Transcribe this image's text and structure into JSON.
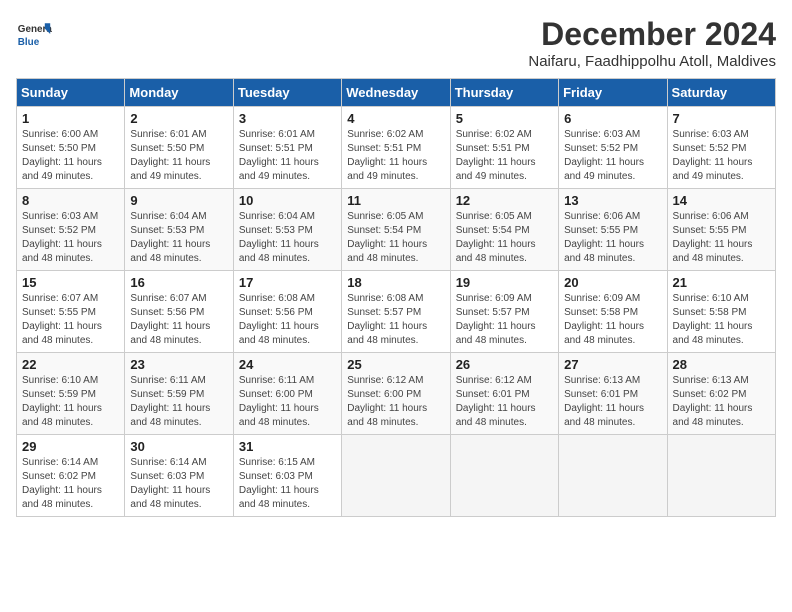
{
  "header": {
    "title": "December 2024",
    "location": "Naifaru, Faadhippolhu Atoll, Maldives",
    "logo_general": "General",
    "logo_blue": "Blue"
  },
  "days_of_week": [
    "Sunday",
    "Monday",
    "Tuesday",
    "Wednesday",
    "Thursday",
    "Friday",
    "Saturday"
  ],
  "weeks": [
    [
      {
        "day": "1",
        "info": "Sunrise: 6:00 AM\nSunset: 5:50 PM\nDaylight: 11 hours\nand 49 minutes."
      },
      {
        "day": "2",
        "info": "Sunrise: 6:01 AM\nSunset: 5:50 PM\nDaylight: 11 hours\nand 49 minutes."
      },
      {
        "day": "3",
        "info": "Sunrise: 6:01 AM\nSunset: 5:51 PM\nDaylight: 11 hours\nand 49 minutes."
      },
      {
        "day": "4",
        "info": "Sunrise: 6:02 AM\nSunset: 5:51 PM\nDaylight: 11 hours\nand 49 minutes."
      },
      {
        "day": "5",
        "info": "Sunrise: 6:02 AM\nSunset: 5:51 PM\nDaylight: 11 hours\nand 49 minutes."
      },
      {
        "day": "6",
        "info": "Sunrise: 6:03 AM\nSunset: 5:52 PM\nDaylight: 11 hours\nand 49 minutes."
      },
      {
        "day": "7",
        "info": "Sunrise: 6:03 AM\nSunset: 5:52 PM\nDaylight: 11 hours\nand 49 minutes."
      }
    ],
    [
      {
        "day": "8",
        "info": "Sunrise: 6:03 AM\nSunset: 5:52 PM\nDaylight: 11 hours\nand 48 minutes."
      },
      {
        "day": "9",
        "info": "Sunrise: 6:04 AM\nSunset: 5:53 PM\nDaylight: 11 hours\nand 48 minutes."
      },
      {
        "day": "10",
        "info": "Sunrise: 6:04 AM\nSunset: 5:53 PM\nDaylight: 11 hours\nand 48 minutes."
      },
      {
        "day": "11",
        "info": "Sunrise: 6:05 AM\nSunset: 5:54 PM\nDaylight: 11 hours\nand 48 minutes."
      },
      {
        "day": "12",
        "info": "Sunrise: 6:05 AM\nSunset: 5:54 PM\nDaylight: 11 hours\nand 48 minutes."
      },
      {
        "day": "13",
        "info": "Sunrise: 6:06 AM\nSunset: 5:55 PM\nDaylight: 11 hours\nand 48 minutes."
      },
      {
        "day": "14",
        "info": "Sunrise: 6:06 AM\nSunset: 5:55 PM\nDaylight: 11 hours\nand 48 minutes."
      }
    ],
    [
      {
        "day": "15",
        "info": "Sunrise: 6:07 AM\nSunset: 5:55 PM\nDaylight: 11 hours\nand 48 minutes."
      },
      {
        "day": "16",
        "info": "Sunrise: 6:07 AM\nSunset: 5:56 PM\nDaylight: 11 hours\nand 48 minutes."
      },
      {
        "day": "17",
        "info": "Sunrise: 6:08 AM\nSunset: 5:56 PM\nDaylight: 11 hours\nand 48 minutes."
      },
      {
        "day": "18",
        "info": "Sunrise: 6:08 AM\nSunset: 5:57 PM\nDaylight: 11 hours\nand 48 minutes."
      },
      {
        "day": "19",
        "info": "Sunrise: 6:09 AM\nSunset: 5:57 PM\nDaylight: 11 hours\nand 48 minutes."
      },
      {
        "day": "20",
        "info": "Sunrise: 6:09 AM\nSunset: 5:58 PM\nDaylight: 11 hours\nand 48 minutes."
      },
      {
        "day": "21",
        "info": "Sunrise: 6:10 AM\nSunset: 5:58 PM\nDaylight: 11 hours\nand 48 minutes."
      }
    ],
    [
      {
        "day": "22",
        "info": "Sunrise: 6:10 AM\nSunset: 5:59 PM\nDaylight: 11 hours\nand 48 minutes."
      },
      {
        "day": "23",
        "info": "Sunrise: 6:11 AM\nSunset: 5:59 PM\nDaylight: 11 hours\nand 48 minutes."
      },
      {
        "day": "24",
        "info": "Sunrise: 6:11 AM\nSunset: 6:00 PM\nDaylight: 11 hours\nand 48 minutes."
      },
      {
        "day": "25",
        "info": "Sunrise: 6:12 AM\nSunset: 6:00 PM\nDaylight: 11 hours\nand 48 minutes."
      },
      {
        "day": "26",
        "info": "Sunrise: 6:12 AM\nSunset: 6:01 PM\nDaylight: 11 hours\nand 48 minutes."
      },
      {
        "day": "27",
        "info": "Sunrise: 6:13 AM\nSunset: 6:01 PM\nDaylight: 11 hours\nand 48 minutes."
      },
      {
        "day": "28",
        "info": "Sunrise: 6:13 AM\nSunset: 6:02 PM\nDaylight: 11 hours\nand 48 minutes."
      }
    ],
    [
      {
        "day": "29",
        "info": "Sunrise: 6:14 AM\nSunset: 6:02 PM\nDaylight: 11 hours\nand 48 minutes."
      },
      {
        "day": "30",
        "info": "Sunrise: 6:14 AM\nSunset: 6:03 PM\nDaylight: 11 hours\nand 48 minutes."
      },
      {
        "day": "31",
        "info": "Sunrise: 6:15 AM\nSunset: 6:03 PM\nDaylight: 11 hours\nand 48 minutes."
      },
      {
        "day": "",
        "info": ""
      },
      {
        "day": "",
        "info": ""
      },
      {
        "day": "",
        "info": ""
      },
      {
        "day": "",
        "info": ""
      }
    ]
  ]
}
